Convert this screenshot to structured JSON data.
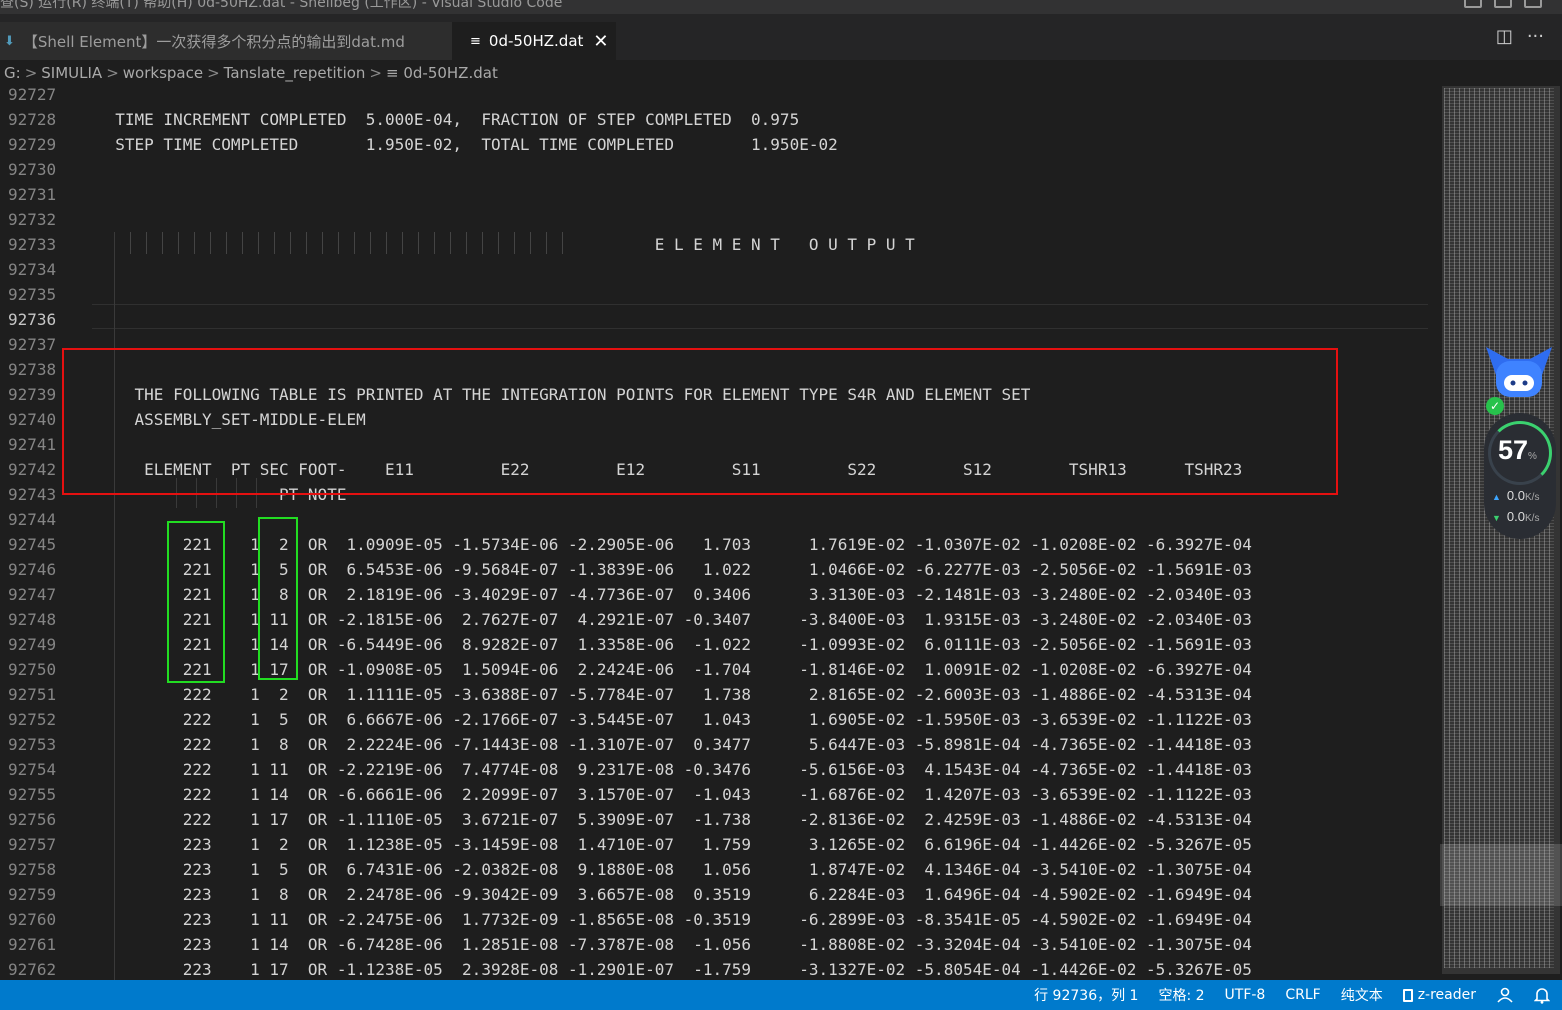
{
  "menubar": {
    "text": "查(S)  运行(R)  终端(T)  帮助(H)       0d-50HZ.dat - Shellbeg (工作区) - Visual Studio Code"
  },
  "tabs": [
    {
      "label": "【Shell Element】一次获得多个积分点的输出到dat.md",
      "icon": "markdown-download-icon"
    },
    {
      "label": "0d-50HZ.dat",
      "icon": "text-file-icon",
      "close": "✕"
    }
  ],
  "tab_actions": {
    "split": "◫",
    "more": "···"
  },
  "breadcrumb": {
    "items": [
      "G:",
      "SIMULIA",
      "workspace",
      "Tanslate_repetition",
      "≡ 0d-50HZ.dat"
    ],
    "separator": ">"
  },
  "editor": {
    "current_line": "92736",
    "lines": [
      {
        "n": "92727",
        "t": ""
      },
      {
        "n": "92728",
        "t": "  TIME INCREMENT COMPLETED  5.000E-04,  FRACTION OF STEP COMPLETED  0.975"
      },
      {
        "n": "92729",
        "t": "  STEP TIME COMPLETED       1.950E-02,  TOTAL TIME COMPLETED        1.950E-02"
      },
      {
        "n": "92730",
        "t": ""
      },
      {
        "n": "92731",
        "t": ""
      },
      {
        "n": "92732",
        "t": ""
      },
      {
        "n": "92733",
        "t": "                                                          E L E M E N T   O U T P U T"
      },
      {
        "n": "92734",
        "t": ""
      },
      {
        "n": "92735",
        "t": ""
      },
      {
        "n": "92736",
        "t": ""
      },
      {
        "n": "92737",
        "t": ""
      },
      {
        "n": "92738",
        "t": ""
      },
      {
        "n": "92739",
        "t": "    THE FOLLOWING TABLE IS PRINTED AT THE INTEGRATION POINTS FOR ELEMENT TYPE S4R AND ELEMENT SET"
      },
      {
        "n": "92740",
        "t": "    ASSEMBLY_SET-MIDDLE-ELEM"
      },
      {
        "n": "92741",
        "t": ""
      },
      {
        "n": "92742",
        "t": "     ELEMENT  PT SEC FOOT-    E11         E22         E12         S11         S22         S12        TSHR13      TSHR23"
      },
      {
        "n": "92743",
        "t": "                   PT NOTE"
      },
      {
        "n": "92744",
        "t": ""
      },
      {
        "n": "92745",
        "t": "         221    1  2  OR  1.0909E-05 -1.5734E-06 -2.2905E-06   1.703      1.7619E-02 -1.0307E-02 -1.0208E-02 -6.3927E-04"
      },
      {
        "n": "92746",
        "t": "         221    1  5  OR  6.5453E-06 -9.5684E-07 -1.3839E-06   1.022      1.0466E-02 -6.2277E-03 -2.5056E-02 -1.5691E-03"
      },
      {
        "n": "92747",
        "t": "         221    1  8  OR  2.1819E-06 -3.4029E-07 -4.7736E-07  0.3406      3.3130E-03 -2.1481E-03 -3.2480E-02 -2.0340E-03"
      },
      {
        "n": "92748",
        "t": "         221    1 11  OR -2.1815E-06  2.7627E-07  4.2921E-07 -0.3407     -3.8400E-03  1.9315E-03 -3.2480E-02 -2.0340E-03"
      },
      {
        "n": "92749",
        "t": "         221    1 14  OR -6.5449E-06  8.9282E-07  1.3358E-06  -1.022     -1.0993E-02  6.0111E-03 -2.5056E-02 -1.5691E-03"
      },
      {
        "n": "92750",
        "t": "         221    1 17  OR -1.0908E-05  1.5094E-06  2.2424E-06  -1.704     -1.8146E-02  1.0091E-02 -1.0208E-02 -6.3927E-04"
      },
      {
        "n": "92751",
        "t": "         222    1  2  OR  1.1111E-05 -3.6388E-07 -5.7784E-07   1.738      2.8165E-02 -2.6003E-03 -1.4886E-02 -4.5313E-04"
      },
      {
        "n": "92752",
        "t": "         222    1  5  OR  6.6667E-06 -2.1766E-07 -3.5445E-07   1.043      1.6905E-02 -1.5950E-03 -3.6539E-02 -1.1122E-03"
      },
      {
        "n": "92753",
        "t": "         222    1  8  OR  2.2224E-06 -7.1443E-08 -1.3107E-07  0.3477      5.6447E-03 -5.8981E-04 -4.7365E-02 -1.4418E-03"
      },
      {
        "n": "92754",
        "t": "         222    1 11  OR -2.2219E-06  7.4774E-08  9.2317E-08 -0.3476     -5.6156E-03  4.1543E-04 -4.7365E-02 -1.4418E-03"
      },
      {
        "n": "92755",
        "t": "         222    1 14  OR -6.6661E-06  2.2099E-07  3.1570E-07  -1.043     -1.6876E-02  1.4207E-03 -3.6539E-02 -1.1122E-03"
      },
      {
        "n": "92756",
        "t": "         222    1 17  OR -1.1110E-05  3.6721E-07  5.3909E-07  -1.738     -2.8136E-02  2.4259E-03 -1.4886E-02 -4.5313E-04"
      },
      {
        "n": "92757",
        "t": "         223    1  2  OR  1.1238E-05 -3.1459E-08  1.4710E-07   1.759      3.1265E-02  6.6196E-04 -1.4426E-02 -5.3267E-05"
      },
      {
        "n": "92758",
        "t": "         223    1  5  OR  6.7431E-06 -2.0382E-08  9.1880E-08   1.056      1.8747E-02  4.1346E-04 -3.5410E-02 -1.3075E-04"
      },
      {
        "n": "92759",
        "t": "         223    1  8  OR  2.2478E-06 -9.3042E-09  3.6657E-08  0.3519      6.2284E-03  1.6496E-04 -4.5902E-02 -1.6949E-04"
      },
      {
        "n": "92760",
        "t": "         223    1 11  OR -2.2475E-06  1.7732E-09 -1.8565E-08 -0.3519     -6.2899E-03 -8.3541E-05 -4.5902E-02 -1.6949E-04"
      },
      {
        "n": "92761",
        "t": "         223    1 14  OR -6.7428E-06  1.2851E-08 -7.3787E-08  -1.056     -1.8808E-02 -3.3204E-04 -3.5410E-02 -1.3075E-04"
      },
      {
        "n": "92762",
        "t": "         223    1 17  OR -1.1238E-05  2.3928E-08 -1.2901E-07  -1.759     -3.1327E-02 -5.8054E-04 -1.4426E-02 -5.3267E-05"
      }
    ]
  },
  "widget": {
    "percent": "57",
    "percent_unit": "%",
    "upload": "0.0",
    "download": "0.0",
    "speed_unit": "K/s",
    "check": "✓"
  },
  "statusbar": {
    "position": "行 92736，列 1",
    "indent": "空格: 2",
    "encoding": "UTF-8",
    "eol": "CRLF",
    "language": "纯文本",
    "extension": "z-reader"
  },
  "colors": {
    "accent": "#007acc",
    "red_box": "#e51010",
    "green_box": "#22dd22",
    "background": "#1e1e1e"
  }
}
